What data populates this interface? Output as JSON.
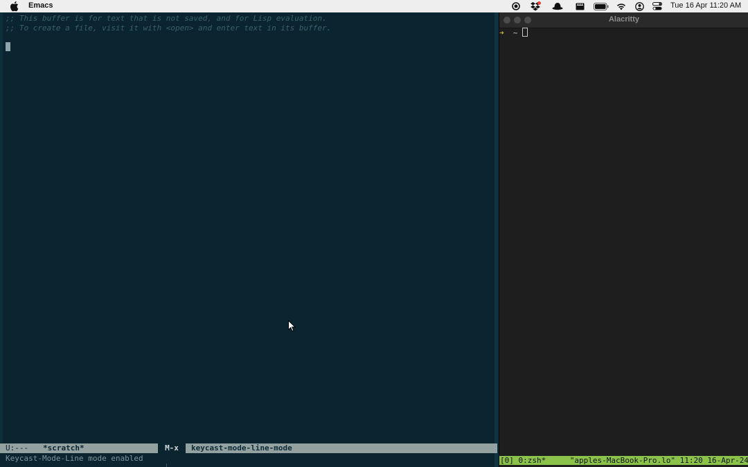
{
  "menubar": {
    "app_name": "Emacs",
    "status_icons": [
      "record-icon",
      "dropbox-icon",
      "bowler-hat-icon",
      "clapper-icon",
      "battery-icon",
      "wifi-icon",
      "user-account-icon",
      "control-center-icon"
    ],
    "clock": "Tue 16 Apr  11:20 AM"
  },
  "emacs": {
    "buffer_lines": [
      ";; This buffer is for text that is not saved, and for Lisp evaluation.",
      ";; To create a file, visit it with <open> and enter text in its buffer."
    ],
    "mode_line": {
      "state": "U:---",
      "buffer_name": "*scratch*",
      "keycast_key": "M-x",
      "keycast_command": "keycast-mode-line-mode"
    },
    "echo_area": "Keycast-Mode-Line mode enabled"
  },
  "alacritty": {
    "title": "Alacritty",
    "prompt": "~",
    "tmux_left": "[0] 0:zsh*",
    "tmux_right": "\"apples-MacBook-Pro.lo\" 11:20 16-Apr-24"
  },
  "colors": {
    "emacs_bg": "#0a2530",
    "mode_line_bg": "#93a1a1",
    "terminal_bg": "#1e1e1e",
    "tmux_bar": "#8bc34a"
  }
}
